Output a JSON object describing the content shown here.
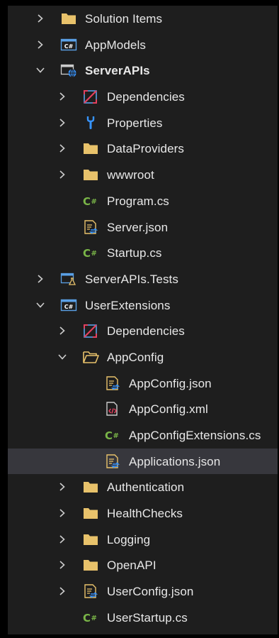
{
  "colors": {
    "background": "#1e1e1e",
    "selected_row": "#37373d",
    "text": "#e8e8e8",
    "folder": "#e8c26b",
    "csharp_file": "#7ab648",
    "dependencies": "#e4405f",
    "properties": "#3794ff",
    "project_border": "#5aa0e6"
  },
  "tree": {
    "items": [
      {
        "label": "Solution Items",
        "icon": "folder-icon"
      },
      {
        "label": "AppModels",
        "icon": "csharp-project-icon"
      },
      {
        "label": "ServerAPIs",
        "icon": "web-project-icon"
      },
      {
        "label": "Dependencies",
        "icon": "dependencies-icon"
      },
      {
        "label": "Properties",
        "icon": "wrench-icon"
      },
      {
        "label": "DataProviders",
        "icon": "folder-icon"
      },
      {
        "label": "wwwroot",
        "icon": "folder-icon"
      },
      {
        "label": "Program.cs",
        "icon": "csharp-file-icon"
      },
      {
        "label": "Server.json",
        "icon": "json-file-icon"
      },
      {
        "label": "Startup.cs",
        "icon": "csharp-file-icon"
      },
      {
        "label": "ServerAPIs.Tests",
        "icon": "test-project-icon"
      },
      {
        "label": "UserExtensions",
        "icon": "csharp-project-icon"
      },
      {
        "label": "Dependencies",
        "icon": "dependencies-icon"
      },
      {
        "label": "AppConfig",
        "icon": "folder-open-icon"
      },
      {
        "label": "AppConfig.json",
        "icon": "json-file-icon"
      },
      {
        "label": "AppConfig.xml",
        "icon": "xml-file-icon"
      },
      {
        "label": "AppConfigExtensions.cs",
        "icon": "csharp-file-icon"
      },
      {
        "label": "Applications.json",
        "icon": "json-file-icon"
      },
      {
        "label": "Authentication",
        "icon": "folder-icon"
      },
      {
        "label": "HealthChecks",
        "icon": "folder-icon"
      },
      {
        "label": "Logging",
        "icon": "folder-icon"
      },
      {
        "label": "OpenAPI",
        "icon": "folder-icon"
      },
      {
        "label": "UserConfig.json",
        "icon": "json-file-icon"
      },
      {
        "label": "UserStartup.cs",
        "icon": "csharp-file-icon"
      }
    ]
  }
}
